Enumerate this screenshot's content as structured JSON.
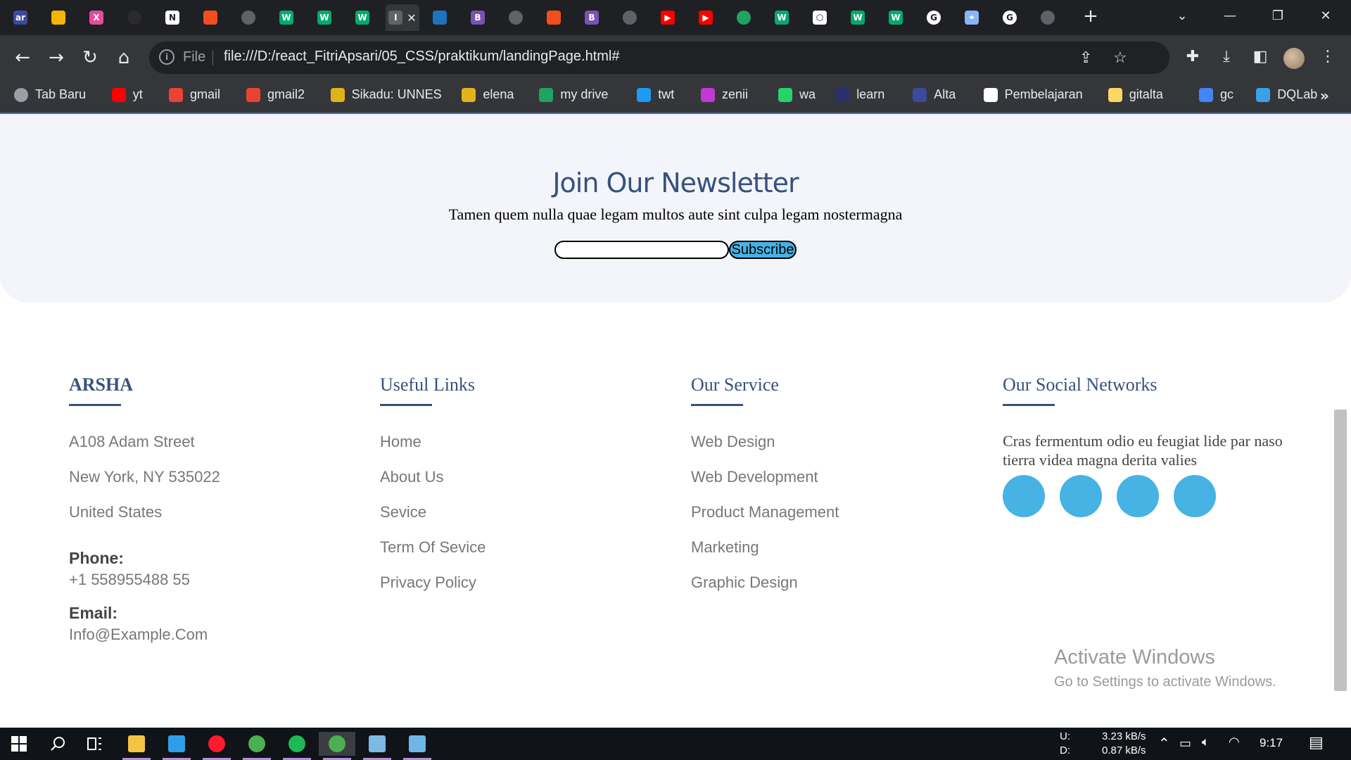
{
  "browser": {
    "tabs": [
      {
        "icon": "app-icon",
        "color": "#3b4a9c",
        "label": "ar"
      },
      {
        "icon": "slides-icon",
        "color": "#f4b400",
        "label": ""
      },
      {
        "icon": "xd-icon",
        "color": "#e34d9a",
        "label": "X"
      },
      {
        "icon": "github-icon",
        "color": "#2b2b2b",
        "label": ""
      },
      {
        "icon": "notion-icon",
        "color": "#ffffff",
        "label": "N"
      },
      {
        "icon": "figma-icon",
        "color": "#f24e1e",
        "label": ""
      },
      {
        "icon": "globe-icon",
        "color": "#5f6368",
        "label": ""
      },
      {
        "icon": "w3schools-icon",
        "color": "#04aa6d",
        "label": "W"
      },
      {
        "icon": "w3schools-icon",
        "color": "#04aa6d",
        "label": "W"
      },
      {
        "icon": "w3schools-icon",
        "color": "#04aa6d",
        "label": "W"
      },
      {
        "icon": "current-tab-icon",
        "color": "#5f6368",
        "label": "I",
        "active": true
      },
      {
        "icon": "codeium-icon",
        "color": "#1c75bc",
        "label": ""
      },
      {
        "icon": "bootstrap-icon",
        "color": "#7952b3",
        "label": "B"
      },
      {
        "icon": "globe-icon",
        "color": "#5f6368",
        "label": ""
      },
      {
        "icon": "figma-icon",
        "color": "#f24e1e",
        "label": ""
      },
      {
        "icon": "bootstrap-icon",
        "color": "#7952b3",
        "label": "B"
      },
      {
        "icon": "globe-icon",
        "color": "#5f6368",
        "label": ""
      },
      {
        "icon": "youtube-icon",
        "color": "#ff0000",
        "label": "▶"
      },
      {
        "icon": "youtube-icon",
        "color": "#ff0000",
        "label": "▶"
      },
      {
        "icon": "drive-icon",
        "color": "#1fa463",
        "label": ""
      },
      {
        "icon": "w3schools-icon",
        "color": "#04aa6d",
        "label": "W"
      },
      {
        "icon": "codepen-icon",
        "color": "#ffffff",
        "label": "⬡"
      },
      {
        "icon": "w3schools-icon",
        "color": "#04aa6d",
        "label": "W"
      },
      {
        "icon": "w3schools-icon",
        "color": "#04aa6d",
        "label": "W"
      },
      {
        "icon": "google-icon",
        "color": "#ffffff",
        "label": "G"
      },
      {
        "icon": "gemini-icon",
        "color": "#8ab4f8",
        "label": "✦"
      },
      {
        "icon": "google-icon",
        "color": "#ffffff",
        "label": "G"
      },
      {
        "icon": "globe-icon",
        "color": "#5f6368",
        "label": ""
      }
    ],
    "address": {
      "scheme": "File",
      "url": "file:///D:/react_FitriApsari/05_CSS/praktikum/landingPage.html#"
    },
    "bookmarks": [
      {
        "label": "Tab Baru",
        "icon": "circle-icon",
        "color": "#9aa0a6"
      },
      {
        "label": "yt",
        "icon": "youtube-icon",
        "color": "#ff0000"
      },
      {
        "label": "gmail",
        "icon": "gmail-icon",
        "color": "#ea4335"
      },
      {
        "label": "gmail2",
        "icon": "gmail-icon",
        "color": "#ea4335"
      },
      {
        "label": "Sikadu: UNNES",
        "icon": "unnes-icon",
        "color": "#e1b31b"
      },
      {
        "label": "elena",
        "icon": "unnes-icon",
        "color": "#e1b31b"
      },
      {
        "label": "my drive",
        "icon": "drive-icon",
        "color": "#1fa463"
      },
      {
        "label": "twt",
        "icon": "twitter-icon",
        "color": "#1d9bf0"
      },
      {
        "label": "zenii",
        "icon": "zenius-icon",
        "color": "#c238d5"
      },
      {
        "label": "wa",
        "icon": "whatsapp-icon",
        "color": "#25d366"
      },
      {
        "label": "learn",
        "icon": "learn-icon",
        "color": "#2b2f6b"
      },
      {
        "label": "Alta",
        "icon": "alta-icon",
        "color": "#3b4a9c"
      },
      {
        "label": "Pembelajaran",
        "icon": "notion-icon",
        "color": "#ffffff"
      },
      {
        "label": "gitalta",
        "icon": "folder-icon",
        "color": "#fdd663"
      },
      {
        "label": "gc",
        "icon": "calendar-icon",
        "color": "#4285f4"
      },
      {
        "label": "DQLab",
        "icon": "dqlab-icon",
        "color": "#3aa0e8"
      }
    ],
    "bookmarks_more": "»"
  },
  "newsletter": {
    "title": "Join Our Newsletter",
    "text": "Tamen quem nulla quae legam multos aute sint culpa legam nostermagna",
    "input_value": "",
    "button_label": "Subscribe"
  },
  "footer": {
    "brand": {
      "title": "ARSHA",
      "address": [
        "A108 Adam Street",
        "New York, NY 535022",
        "United States"
      ],
      "phone_label": "Phone:",
      "phone": "+1 558955488 55",
      "email_label": "Email:",
      "email": "Info@Example.Com"
    },
    "useful_links": {
      "title": "Useful Links",
      "items": [
        "Home",
        "About Us",
        "Sevice",
        "Term Of Sevice",
        "Privacy Policy"
      ]
    },
    "services": {
      "title": "Our Service",
      "items": [
        "Web Design",
        "Web Development",
        "Product Management",
        "Marketing",
        "Graphic Design"
      ]
    },
    "social": {
      "title": "Our Social Networks",
      "text": "Cras fermentum odio eu feugiat lide par naso tierra videa magna derita valies",
      "button_count": 4,
      "button_color": "#47b2e4"
    }
  },
  "watermark": {
    "title": "Activate Windows",
    "subtitle": "Go to Settings to activate Windows."
  },
  "taskbar": {
    "apps": [
      {
        "icon": "explorer-icon",
        "color": "#f4c542"
      },
      {
        "icon": "vscode-icon",
        "color": "#2f9ee8"
      },
      {
        "icon": "opera-icon",
        "color": "#ff1b2d"
      },
      {
        "icon": "chrome-icon",
        "color": "#4caf50"
      },
      {
        "icon": "spotify-icon",
        "color": "#1db954"
      },
      {
        "icon": "chrome-icon",
        "color": "#4caf50",
        "active": true
      },
      {
        "icon": "notepad-icon",
        "color": "#7fb9e6"
      },
      {
        "icon": "app-window-icon",
        "color": "#6fb6e8"
      }
    ],
    "net_up_label": "U:",
    "net_down_label": "D:",
    "net_up": "3.23 kB/s",
    "net_down": "0.87 kB/s",
    "time": "9:17"
  },
  "colors": {
    "accent": "#47b2e4",
    "heading": "#37517e",
    "newsletter_bg": "#f3f5fa"
  }
}
